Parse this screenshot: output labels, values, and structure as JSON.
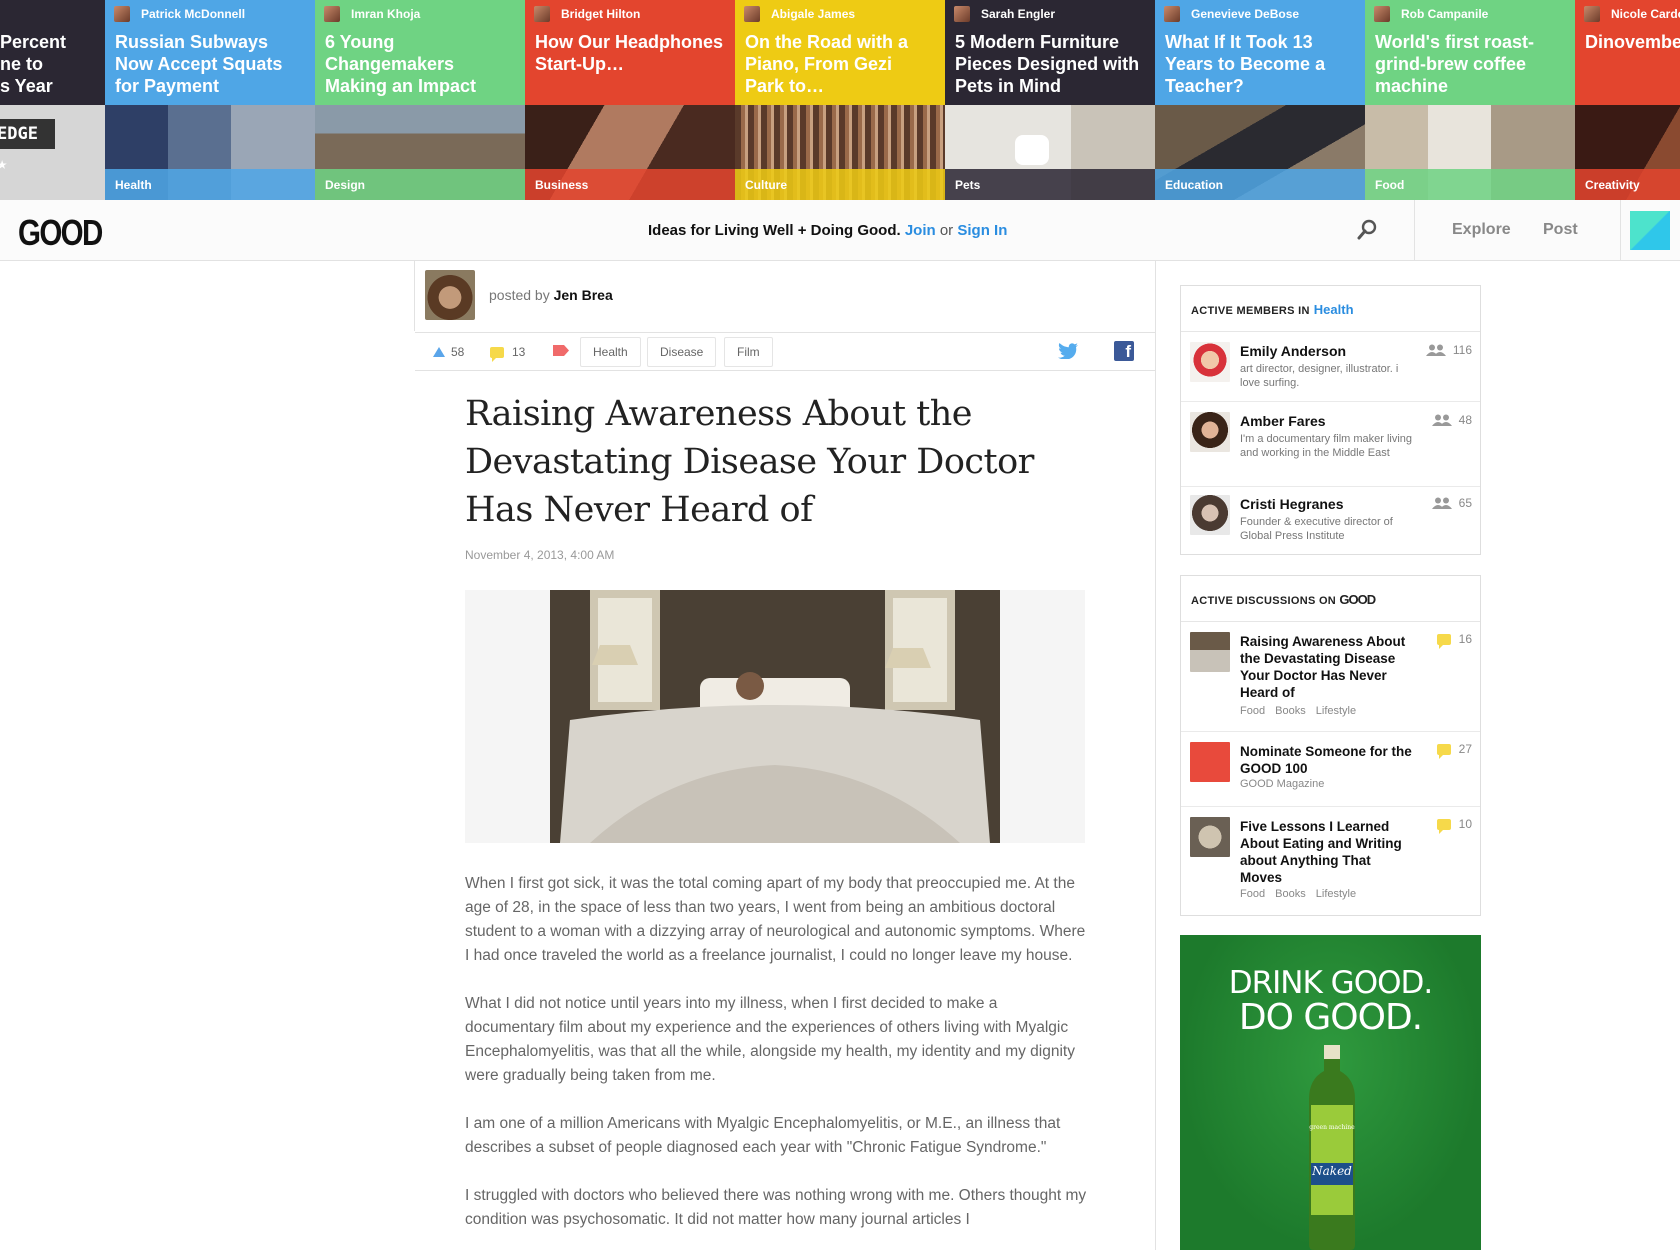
{
  "strip": [
    {
      "author": "",
      "title": "Percent\nne to\ns Year",
      "category": "",
      "head": "#2b2733",
      "band": "#2b2733",
      "pic": "#1d1b22"
    },
    {
      "author": "Patrick McDonnell",
      "title": "Russian Subways Now Accept Squats for Payment",
      "category": "Health",
      "head": "#4fa6e6",
      "band": "#4fa6e6",
      "pic": "#3b4b6d"
    },
    {
      "author": "Imran Khoja",
      "title": "6 Young Changemakers Making an Impact",
      "category": "Design",
      "head": "#6fd383",
      "band": "#6fd383",
      "pic": "#6d7a7d"
    },
    {
      "author": "Bridget Hilton",
      "title": "How Our Headphones Start-Up…",
      "category": "Business",
      "head": "#e3452e",
      "band": "#e3452e",
      "pic": "#6a3a2c"
    },
    {
      "author": "Abigale James",
      "title": "On the Road with a Piano, From Gezi Park to…",
      "category": "Culture",
      "head": "#eecb14",
      "band": "#eecb14",
      "pic": "#6b4a36"
    },
    {
      "author": "Sarah Engler",
      "title": "5 Modern Furniture Pieces Designed with Pets in Mind",
      "category": "Pets",
      "head": "#2b2733",
      "band": "#2b2733",
      "pic": "#d8d6d0"
    },
    {
      "author": "Genevieve DeBose",
      "title": "What If It Took 13 Years to Become a Teacher?",
      "category": "Education",
      "head": "#4fa6e6",
      "band": "#4fa6e6",
      "pic": "#4a4a40"
    },
    {
      "author": "Rob Campanile",
      "title": "World's first roast-grind-brew coffee machine",
      "category": "Food",
      "head": "#6fd383",
      "band": "#6fd383",
      "pic": "#b8aa98"
    },
    {
      "author": "Nicole Cardo",
      "title": "Dinovember Parents Ins Kids to Sta",
      "category": "Creativity",
      "head": "#e3452e",
      "band": "#e3452e",
      "pic": "#5a3a2c"
    }
  ],
  "header": {
    "logo": "GOOD",
    "tagline": "Ideas for Living Well + Doing Good.",
    "join": "Join",
    "or": "or",
    "signin": "Sign In",
    "explore": "Explore",
    "post": "Post"
  },
  "article": {
    "posted_by_label": "posted by",
    "author": "Jen Brea",
    "upvotes": "58",
    "comments": "13",
    "tags": [
      "Health",
      "Disease",
      "Film"
    ],
    "title": "Raising Awareness About the Devastating Disease Your Doctor Has Never Heard of",
    "date": "November 4, 2013, 4:00 AM",
    "paragraphs": [
      "When I first got sick, it was the total coming apart of my body that preoccupied me. At the age of 28, in the space of less than two years, I went from being an ambitious doctoral student to a woman with a dizzying array of neurological and autonomic symptoms. Where I had once traveled the world as a freelance journalist, I could no longer leave my house.",
      "What I did not notice until years into my illness, when I first decided to make a documentary film about my experience and the experiences of others living with Myalgic Encephalomyelitis, was that all the while, alongside my health, my identity and my dignity were gradually being taken from me.",
      "I am one of a million Americans with Myalgic Encephalomyelitis, or M.E., an illness that describes a subset of people diagnosed each year with \"Chronic Fatigue Syndrome.\"",
      "I struggled with doctors who believed there was nothing wrong with me. Others thought my condition was psychosomatic. It did not matter how many journal articles I"
    ]
  },
  "members": {
    "heading": "ACTIVE MEMBERS IN",
    "topic": "Health",
    "items": [
      {
        "name": "Emily Anderson",
        "desc": "art director, designer, illustrator. i love surfing.",
        "count": "116"
      },
      {
        "name": "Amber Fares",
        "desc": "I'm a documentary film maker living and working in the Middle East",
        "count": "48"
      },
      {
        "name": "Cristi Hegranes",
        "desc": "Founder & executive director of Global Press Institute",
        "count": "65"
      }
    ]
  },
  "discussions": {
    "heading": "ACTIVE DISCUSSIONS ON",
    "brand": "GOOD",
    "items": [
      {
        "title": "Raising Awareness About the Devastating Disease Your Doctor Has Never Heard of",
        "cats": "Food Books Lifestyle",
        "count": "16"
      },
      {
        "title": "Nominate Someone for the GOOD 100",
        "cats": "GOOD Magazine",
        "count": "27"
      },
      {
        "title": "Five Lessons I Learned About Eating and Writing about Anything That Moves",
        "cats": "Food Books Lifestyle",
        "count": "10"
      }
    ]
  },
  "ad": {
    "line1": "DRINK GOOD.",
    "line2": "DO GOOD.",
    "bottle_label": "Naked",
    "bottle_sub": "green machine"
  }
}
